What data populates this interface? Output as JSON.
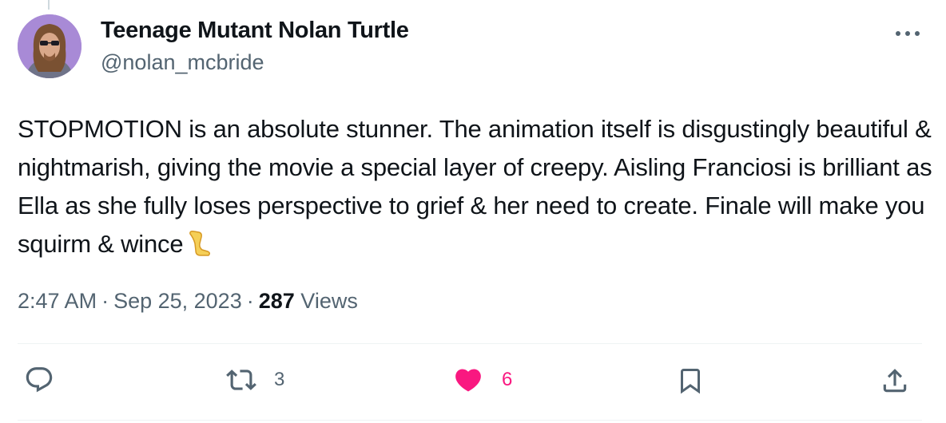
{
  "author": {
    "display_name": "Teenage Mutant Nolan Turtle",
    "handle": "@nolan_mcbride",
    "avatar": "avatar-photo"
  },
  "tweet": {
    "text": "STOPMOTION is an absolute stunner. The animation itself is disgustingly beautiful & nightmarish, giving the movie a special layer of creepy. Aisling Franciosi is brilliant as Ella as she fully loses perspective to grief & her need to create. Finale will make you squirm & wince",
    "emoji": "leg-emoji"
  },
  "meta": {
    "time": "2:47 AM",
    "separator": "·",
    "date": "Sep 25, 2023",
    "views_count": "287",
    "views_label": "Views"
  },
  "actions": {
    "reply": {
      "icon": "reply-icon"
    },
    "retweet": {
      "icon": "retweet-icon",
      "count": "3"
    },
    "like": {
      "icon": "heart-icon",
      "count": "6"
    },
    "bookmark": {
      "icon": "bookmark-icon"
    },
    "share": {
      "icon": "share-icon"
    }
  },
  "colors": {
    "text": "#0f1419",
    "secondary": "#536471",
    "like": "#f91880",
    "divider": "#eff3f4"
  }
}
